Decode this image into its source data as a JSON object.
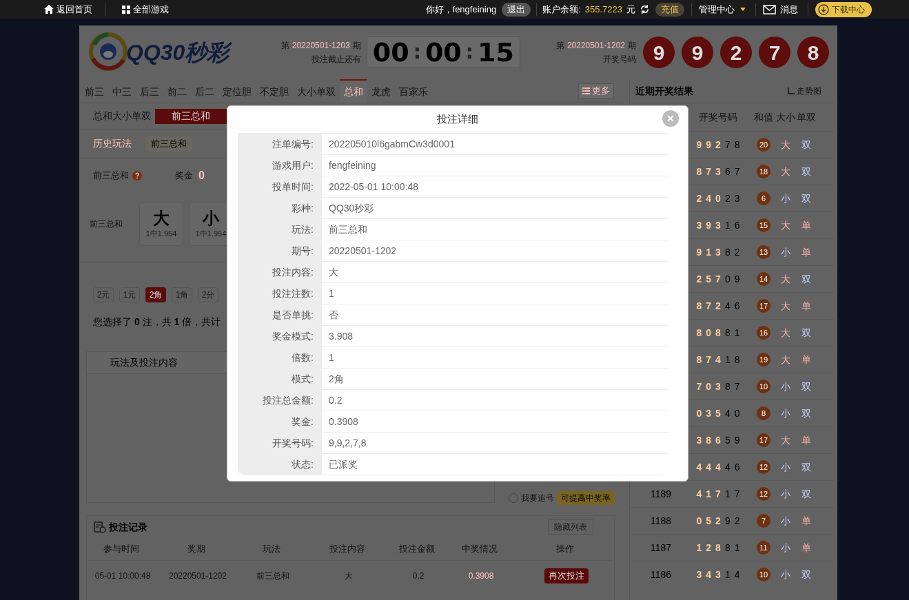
{
  "top_bar": {
    "home": "返回首页",
    "all_games": "全部游戏",
    "greeting": "你好，fengfeining",
    "logout": "退出",
    "balance_label": "账户余额:",
    "balance": "355.7223",
    "currency": "元",
    "recharge": "充值",
    "admin": "管理中心",
    "messages": "消息",
    "download": "下载中心"
  },
  "header": {
    "logo": "QQ30秒彩",
    "current": {
      "prefix": "第",
      "issue": "20220501-1203",
      "suffix": "期",
      "caption": "投注截止还有"
    },
    "countdown": [
      "00",
      "00",
      "15"
    ],
    "separator": ":",
    "last": {
      "prefix": "第",
      "issue": "20220501-1202",
      "suffix": "期",
      "caption": "开奖号码"
    },
    "balls": [
      "9",
      "9",
      "2",
      "7",
      "8"
    ]
  },
  "tabs": [
    {
      "label": "前三",
      "selected": false
    },
    {
      "label": "中三",
      "selected": false
    },
    {
      "label": "后三",
      "selected": false
    },
    {
      "label": "前二",
      "selected": false
    },
    {
      "label": "后二",
      "selected": false
    },
    {
      "label": "定位胆",
      "selected": false
    },
    {
      "label": "不定胆",
      "selected": false
    },
    {
      "label": "大小单双",
      "selected": false
    },
    {
      "label": "总和",
      "selected": true
    },
    {
      "label": "龙虎",
      "selected": false
    },
    {
      "label": "百家乐",
      "selected": false
    }
  ],
  "more": "更多",
  "sub_group": {
    "label": "总和大小单双",
    "options": [
      {
        "label": "前三总和",
        "selected": true
      }
    ]
  },
  "history": {
    "label": "历史玩法",
    "items": [
      "前三总和"
    ]
  },
  "play": {
    "name": "前三总和",
    "prize_label": "奖金",
    "prize": "0"
  },
  "balls_row": {
    "label": "前三总和",
    "options": [
      {
        "value": "大",
        "odds": "1中1.954"
      },
      {
        "value": "小",
        "odds": "1中1.954"
      }
    ]
  },
  "units": [
    {
      "label": "2元",
      "selected": false
    },
    {
      "label": "1元",
      "selected": false
    },
    {
      "label": "2角",
      "selected": true
    },
    {
      "label": "1角",
      "selected": false
    },
    {
      "label": "2分",
      "selected": false
    }
  ],
  "summary": "您选择了 **0** 注，共 **1** 倍，共计",
  "bet_box": {
    "column": "玩法及投注内容"
  },
  "chase": {
    "label": "我要追号",
    "checked": false,
    "badge": "可提高中奖率"
  },
  "records": {
    "title": "投注记录",
    "hide": "隐藏列表",
    "columns": [
      "参与时间",
      "奖期",
      "玩法",
      "投注内容",
      "投注金额",
      "中奖情况",
      "操作"
    ],
    "rows": [
      {
        "cells": [
          "05-01 10:00:48",
          "20220501-1202",
          "前三总和",
          "大",
          "0.2",
          "0.3908"
        ],
        "action": "再次投注"
      }
    ]
  },
  "results": {
    "title": "近期开奖结果",
    "trend": "走势图",
    "columns": [
      "开奖号码",
      "和值",
      "大小",
      "单双"
    ],
    "rows": [
      {
        "digits": [
          "9",
          "9",
          "2",
          "7",
          "8"
        ],
        "sum": "20",
        "size": {
          "text": "大",
          "color": "#ffb0b0"
        },
        "parity": {
          "text": "双",
          "color": "#c8d0ff"
        }
      },
      {
        "digits": [
          "8",
          "7",
          "3",
          "6",
          "7"
        ],
        "sum": "18",
        "size": {
          "text": "大",
          "color": "#ffb0b0"
        },
        "parity": {
          "text": "双",
          "color": "#c8d0ff"
        }
      },
      {
        "digits": [
          "2",
          "4",
          "0",
          "2",
          "3"
        ],
        "sum": "6",
        "size": {
          "text": "小",
          "color": "#c8d0ff"
        },
        "parity": {
          "text": "双",
          "color": "#c8d0ff"
        }
      },
      {
        "digits": [
          "3",
          "9",
          "3",
          "1",
          "6"
        ],
        "sum": "15",
        "size": {
          "text": "大",
          "color": "#ffb0b0"
        },
        "parity": {
          "text": "单",
          "color": "#ffb0b0"
        }
      },
      {
        "digits": [
          "9",
          "1",
          "3",
          "8",
          "2"
        ],
        "sum": "13",
        "size": {
          "text": "小",
          "color": "#c8d0ff"
        },
        "parity": {
          "text": "单",
          "color": "#ffb0b0"
        }
      },
      {
        "digits": [
          "2",
          "5",
          "7",
          "0",
          "9"
        ],
        "sum": "14",
        "size": {
          "text": "大",
          "color": "#ffb0b0"
        },
        "parity": {
          "text": "双",
          "color": "#c8d0ff"
        }
      },
      {
        "digits": [
          "8",
          "7",
          "2",
          "4",
          "6"
        ],
        "sum": "17",
        "size": {
          "text": "大",
          "color": "#ffb0b0"
        },
        "parity": {
          "text": "单",
          "color": "#ffb0b0"
        }
      },
      {
        "digits": [
          "8",
          "0",
          "8",
          "8",
          "1"
        ],
        "sum": "16",
        "size": {
          "text": "大",
          "color": "#ffb0b0"
        },
        "parity": {
          "text": "双",
          "color": "#c8d0ff"
        }
      },
      {
        "digits": [
          "8",
          "7",
          "4",
          "1",
          "8"
        ],
        "sum": "19",
        "size": {
          "text": "大",
          "color": "#ffb0b0"
        },
        "parity": {
          "text": "单",
          "color": "#ffb0b0"
        }
      },
      {
        "digits": [
          "7",
          "0",
          "3",
          "8",
          "7"
        ],
        "sum": "10",
        "size": {
          "text": "小",
          "color": "#c8d0ff"
        },
        "parity": {
          "text": "双",
          "color": "#c8d0ff"
        }
      },
      {
        "digits": [
          "0",
          "3",
          "5",
          "4",
          "0"
        ],
        "sum": "8",
        "size": {
          "text": "小",
          "color": "#c8d0ff"
        },
        "parity": {
          "text": "双",
          "color": "#c8d0ff"
        }
      },
      {
        "digits": [
          "3",
          "8",
          "6",
          "5",
          "9"
        ],
        "sum": "17",
        "size": {
          "text": "大",
          "color": "#ffb0b0"
        },
        "parity": {
          "text": "单",
          "color": "#ffb0b0"
        }
      },
      {
        "digits": [
          "4",
          "4",
          "4",
          "4",
          "6"
        ],
        "sum": "12",
        "size": {
          "text": "小",
          "color": "#c8d0ff"
        },
        "parity": {
          "text": "双",
          "color": "#c8d0ff"
        }
      },
      {
        "issue": "1189",
        "digits": [
          "4",
          "1",
          "7",
          "1",
          "7"
        ],
        "sum": "12",
        "size": {
          "text": "小",
          "color": "#c8d0ff"
        },
        "parity": {
          "text": "双",
          "color": "#c8d0ff"
        }
      },
      {
        "issue": "1188",
        "digits": [
          "0",
          "5",
          "2",
          "9",
          "2"
        ],
        "sum": "7",
        "size": {
          "text": "小",
          "color": "#c8d0ff"
        },
        "parity": {
          "text": "单",
          "color": "#ffb0b0"
        }
      },
      {
        "issue": "1187",
        "digits": [
          "1",
          "2",
          "8",
          "8",
          "1"
        ],
        "sum": "11",
        "size": {
          "text": "小",
          "color": "#c8d0ff"
        },
        "parity": {
          "text": "单",
          "color": "#ffb0b0"
        }
      },
      {
        "issue": "1186",
        "digits": [
          "3",
          "4",
          "3",
          "1",
          "4"
        ],
        "sum": "10",
        "size": {
          "text": "小",
          "color": "#c8d0ff"
        },
        "parity": {
          "text": "双",
          "color": "#c8d0ff"
        }
      }
    ]
  },
  "modal": {
    "title": "投注详细",
    "fields": [
      {
        "label": "注单编号:",
        "value": "202205010l6gabmCw3d0001"
      },
      {
        "label": "游戏用户:",
        "value": "fengfeining"
      },
      {
        "label": "投单时间:",
        "value": "2022-05-01 10:00:48"
      },
      {
        "label": "彩种:",
        "value": "QQ30秒彩"
      },
      {
        "label": "玩法:",
        "value": "前三总和"
      },
      {
        "label": "期号:",
        "value": "20220501-1202"
      },
      {
        "label": "投注内容:",
        "value": "大"
      },
      {
        "label": "投注注数:",
        "value": "1"
      },
      {
        "label": "是否单挑:",
        "value": "否"
      },
      {
        "label": "奖金模式:",
        "value": "3.908"
      },
      {
        "label": "倍数:",
        "value": "1"
      },
      {
        "label": "模式:",
        "value": "2角"
      },
      {
        "label": "投注总金额:",
        "value": "0.2"
      },
      {
        "label": "奖金:",
        "value": "0.3908"
      },
      {
        "label": "开奖号码:",
        "value": "9,9,2,7,8"
      },
      {
        "label": "状态:",
        "value": "已派奖"
      }
    ]
  }
}
